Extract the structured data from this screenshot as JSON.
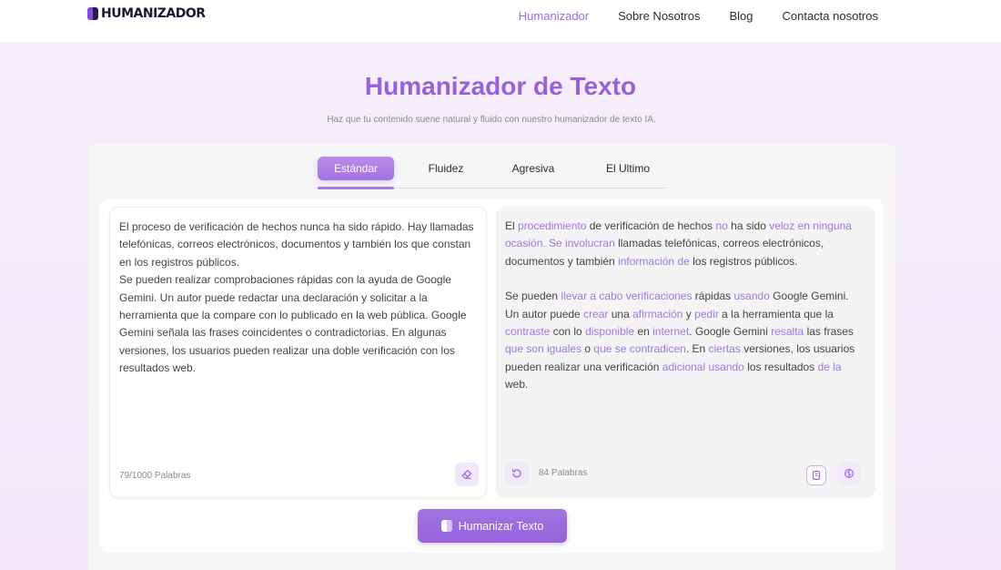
{
  "header": {
    "logo_text": "HUMANIZADOR",
    "nav": [
      {
        "label": "Humanizador",
        "active": true
      },
      {
        "label": "Sobre Nosotros",
        "active": false
      },
      {
        "label": "Blog",
        "active": false
      },
      {
        "label": "Contacta nosotros",
        "active": false
      }
    ]
  },
  "hero": {
    "title": "Humanizador de Texto",
    "subtitle": "Haz que tu contenido suene natural y fluido con nuestro humanizador de texto IA."
  },
  "tabs": [
    {
      "label": "Estándar",
      "active": true
    },
    {
      "label": "Fluidez",
      "active": false
    },
    {
      "label": "Agresiva",
      "active": false
    },
    {
      "label": "El Ultimo",
      "active": false
    }
  ],
  "input_panel": {
    "text_p1": "El proceso de verificación de hechos nunca ha sido rápido. Hay llamadas telefónicas, correos electrónicos, documentos y también los que constan en los registros públicos.",
    "text_p2": "Se pueden realizar comprobaciones rápidas con la ayuda de Google Gemini. Un autor puede redactar una declaración y solicitar a la herramienta que la compare con lo publicado en la web pública. Google Gemini señala las frases coincidentes o contradictorias. En algunas versiones, los usuarios pueden realizar una doble verificación con los resultados web.",
    "word_count": "79/1000 Palabras"
  },
  "output_panel": {
    "word_count": "84 Palabras",
    "p1": [
      {
        "t": "El ",
        "h": false
      },
      {
        "t": "procedimiento",
        "h": true
      },
      {
        "t": " de verificación de hechos ",
        "h": false
      },
      {
        "t": "no",
        "h": true
      },
      {
        "t": " ha sido ",
        "h": false
      },
      {
        "t": "veloz en ninguna ocasión. Se involucran",
        "h": true
      },
      {
        "t": " llamadas telefónicas, correos electrónicos, documentos y también ",
        "h": false
      },
      {
        "t": "información de",
        "h": true
      },
      {
        "t": " los registros públicos.",
        "h": false
      }
    ],
    "p2": [
      {
        "t": "Se pueden ",
        "h": false
      },
      {
        "t": "llevar a cabo verificaciones",
        "h": true
      },
      {
        "t": " rápidas ",
        "h": false
      },
      {
        "t": "usando",
        "h": true
      },
      {
        "t": " Google Gemini. Un autor puede ",
        "h": false
      },
      {
        "t": "crear",
        "h": true
      },
      {
        "t": " una ",
        "h": false
      },
      {
        "t": "afirmación",
        "h": true
      },
      {
        "t": " y ",
        "h": false
      },
      {
        "t": "pedir",
        "h": true
      },
      {
        "t": " a la herramienta que la ",
        "h": false
      },
      {
        "t": "contraste",
        "h": true
      },
      {
        "t": " con lo ",
        "h": false
      },
      {
        "t": "disponible",
        "h": true
      },
      {
        "t": " en ",
        "h": false
      },
      {
        "t": "internet",
        "h": true
      },
      {
        "t": ". Google Gemini ",
        "h": false
      },
      {
        "t": "resalta",
        "h": true
      },
      {
        "t": " las frases ",
        "h": false
      },
      {
        "t": "que son iguales",
        "h": true
      },
      {
        "t": " o ",
        "h": false
      },
      {
        "t": "que se contradicen",
        "h": true
      },
      {
        "t": ". En ",
        "h": false
      },
      {
        "t": "ciertas",
        "h": true
      },
      {
        "t": " versiones, los usuarios pueden realizar una verificación ",
        "h": false
      },
      {
        "t": "adicional usando",
        "h": true
      },
      {
        "t": " los resultados ",
        "h": false
      },
      {
        "t": "de la",
        "h": true
      },
      {
        "t": " web.",
        "h": false
      }
    ]
  },
  "cta": {
    "label": "Humanizar Texto"
  },
  "colors": {
    "accent": "#9b5fd9",
    "highlight": "#a276e0",
    "hero_bg": "#f3eafa"
  }
}
